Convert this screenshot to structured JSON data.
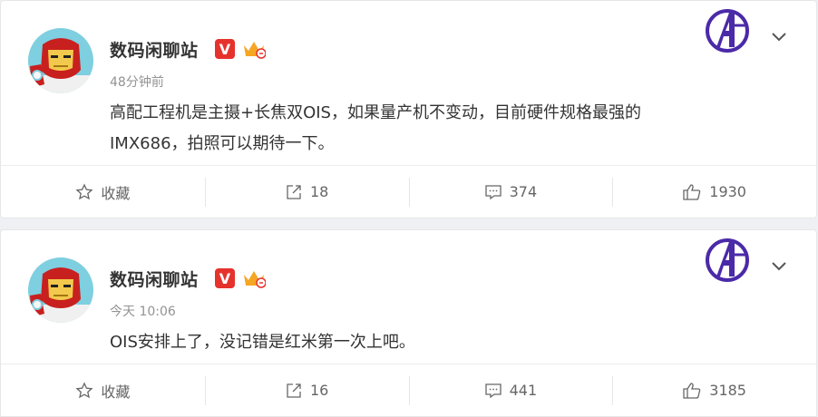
{
  "posts": [
    {
      "author": "数码闲聊站",
      "time": "48分钟前",
      "text_lines": [
        "高配工程机是主摄+长焦双OIS，如果量产机不变动，目前硬件规格最强的",
        "IMX686，拍照可以期待一下。"
      ],
      "actions": {
        "favorite": "收藏",
        "repost": "18",
        "comment": "374",
        "like": "1930"
      }
    },
    {
      "author": "数码闲聊站",
      "time": "今天 10:06",
      "text_lines": [
        "OIS安排上了，没记错是红米第一次上吧。"
      ],
      "actions": {
        "favorite": "收藏",
        "repost": "16",
        "comment": "441",
        "like": "3185"
      }
    }
  ],
  "badge": {
    "verified_letter": "V"
  },
  "colors": {
    "verified": "#e6322d",
    "crown": "#f5a623",
    "logo": "#4b2aa8",
    "text": "#333333",
    "meta": "#939393"
  },
  "icons": [
    "iron-man-avatar",
    "verified-icon",
    "crown-icon",
    "avengers-logo-icon",
    "chevron-down-icon",
    "star-icon",
    "repost-icon",
    "comment-icon",
    "like-icon"
  ]
}
